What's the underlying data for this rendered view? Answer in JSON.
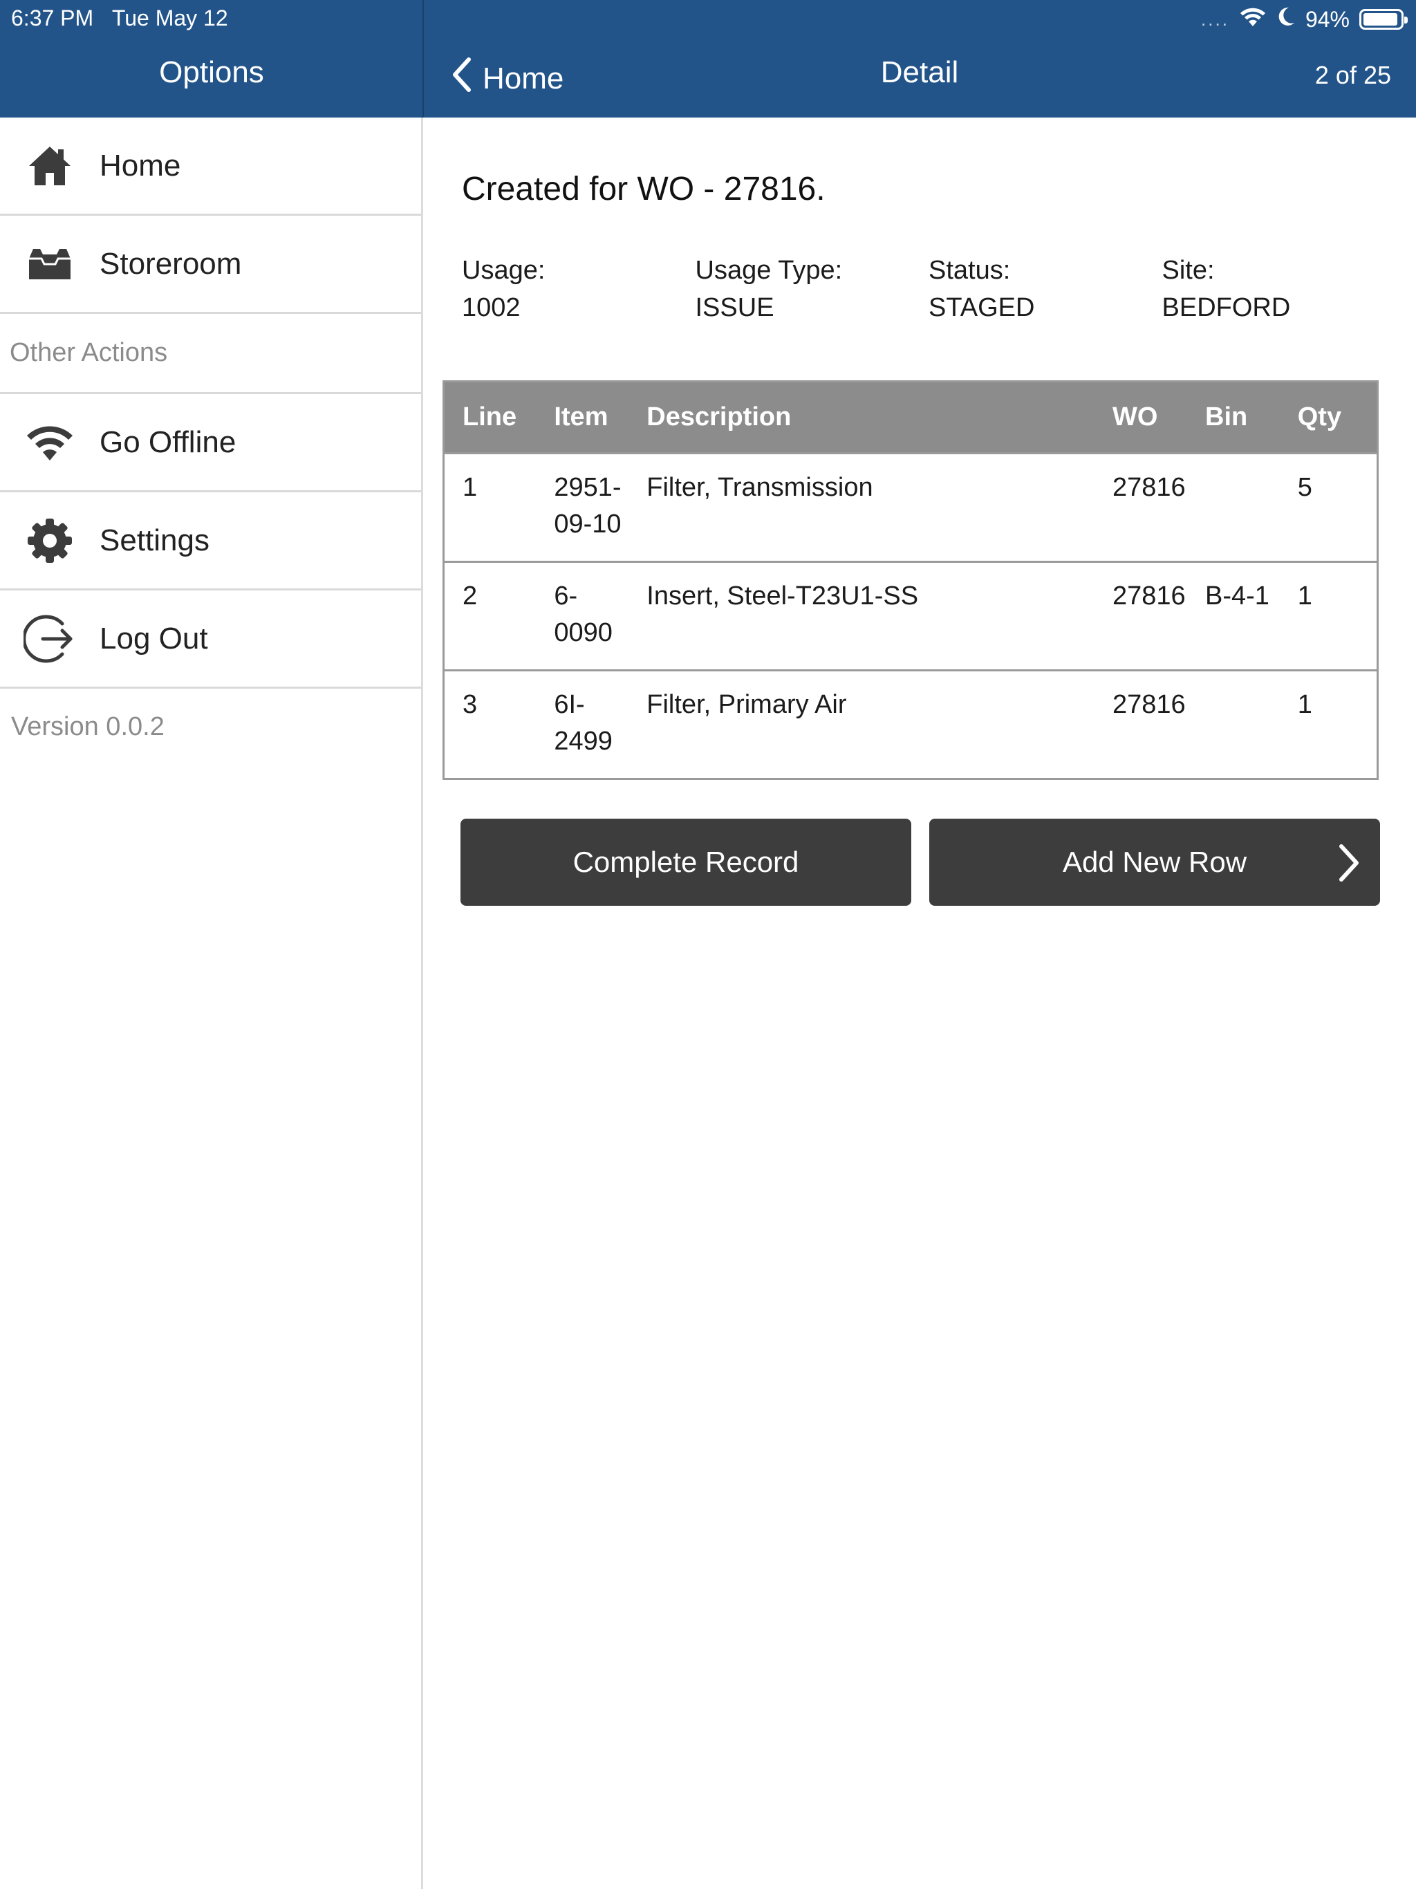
{
  "status_bar": {
    "time": "6:37 PM",
    "date": "Tue May 12",
    "signal_dots": "....",
    "battery": "94%",
    "battery_fraction": 0.94
  },
  "nav": {
    "sidebar_title": "Options",
    "back_label": "Home",
    "title": "Detail",
    "position": "2 of 25"
  },
  "sidebar": {
    "items": [
      {
        "label": "Home",
        "icon": "home-icon"
      },
      {
        "label": "Storeroom",
        "icon": "storeroom-icon"
      }
    ],
    "section_label": "Other Actions",
    "actions": [
      {
        "label": "Go Offline",
        "icon": "wifi-icon"
      },
      {
        "label": "Settings",
        "icon": "gear-icon"
      },
      {
        "label": "Log Out",
        "icon": "logout-icon"
      }
    ],
    "version": "Version 0.0.2"
  },
  "detail": {
    "title": "Created for WO - 27816.",
    "fields": [
      {
        "label": "Usage:",
        "value": "1002"
      },
      {
        "label": "Usage Type:",
        "value": "ISSUE"
      },
      {
        "label": "Status:",
        "value": "STAGED"
      },
      {
        "label": "Site:",
        "value": "BEDFORD"
      }
    ],
    "table": {
      "headers": [
        "Line",
        "Item",
        "Description",
        "WO",
        "Bin",
        "Qty"
      ],
      "rows": [
        {
          "line": "1",
          "item": "2951-09-10",
          "description": "Filter, Transmission",
          "wo": "27816",
          "bin": "",
          "qty": "5"
        },
        {
          "line": "2",
          "item": "6-0090",
          "description": "Insert, Steel-T23U1-SS",
          "wo": "27816",
          "bin": "B-4-1",
          "qty": "1"
        },
        {
          "line": "3",
          "item": "6I-2499",
          "description": "Filter, Primary Air",
          "wo": "27816",
          "bin": "",
          "qty": "1"
        }
      ]
    },
    "buttons": {
      "complete": "Complete Record",
      "add_row": "Add New Row"
    }
  },
  "colors": {
    "header_bg": "#22548a",
    "table_header_bg": "#8c8c8c",
    "button_bg": "#3d3d3d",
    "muted_text": "#8b8b8b"
  }
}
